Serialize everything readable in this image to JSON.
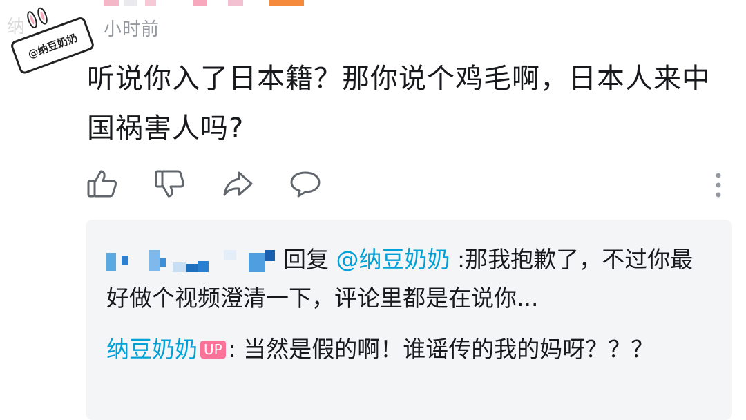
{
  "header": {
    "timestamp": "小时前",
    "watermark_fragment": "纳"
  },
  "watermark": {
    "text": "@纳豆奶奶",
    "kind": "sticker-logo"
  },
  "comment": {
    "text": "听说你入了日本籍？那你说个鸡毛啊，日本人来中国祸害人吗?"
  },
  "actions": {
    "like_icon": "thumbs-up-icon",
    "dislike_icon": "thumbs-down-icon",
    "share_icon": "share-icon",
    "reply_icon": "comment-icon",
    "more_icon": "more-vertical-icon"
  },
  "replies": [
    {
      "reply_word": "回复",
      "mention": "@纳豆奶奶",
      "text": ":那我抱歉了，不过你最好做个视频澄清一下，评论里都是在说你..."
    },
    {
      "author": "纳豆奶奶",
      "badge": "UP",
      "text": ": 当然是假的啊！谁谣传的我的妈呀？？？"
    }
  ],
  "colors": {
    "link_blue": "#00a1d6",
    "up_pink": "#fb7299",
    "reply_bg": "#f4f5f7",
    "muted": "#9499a0"
  }
}
